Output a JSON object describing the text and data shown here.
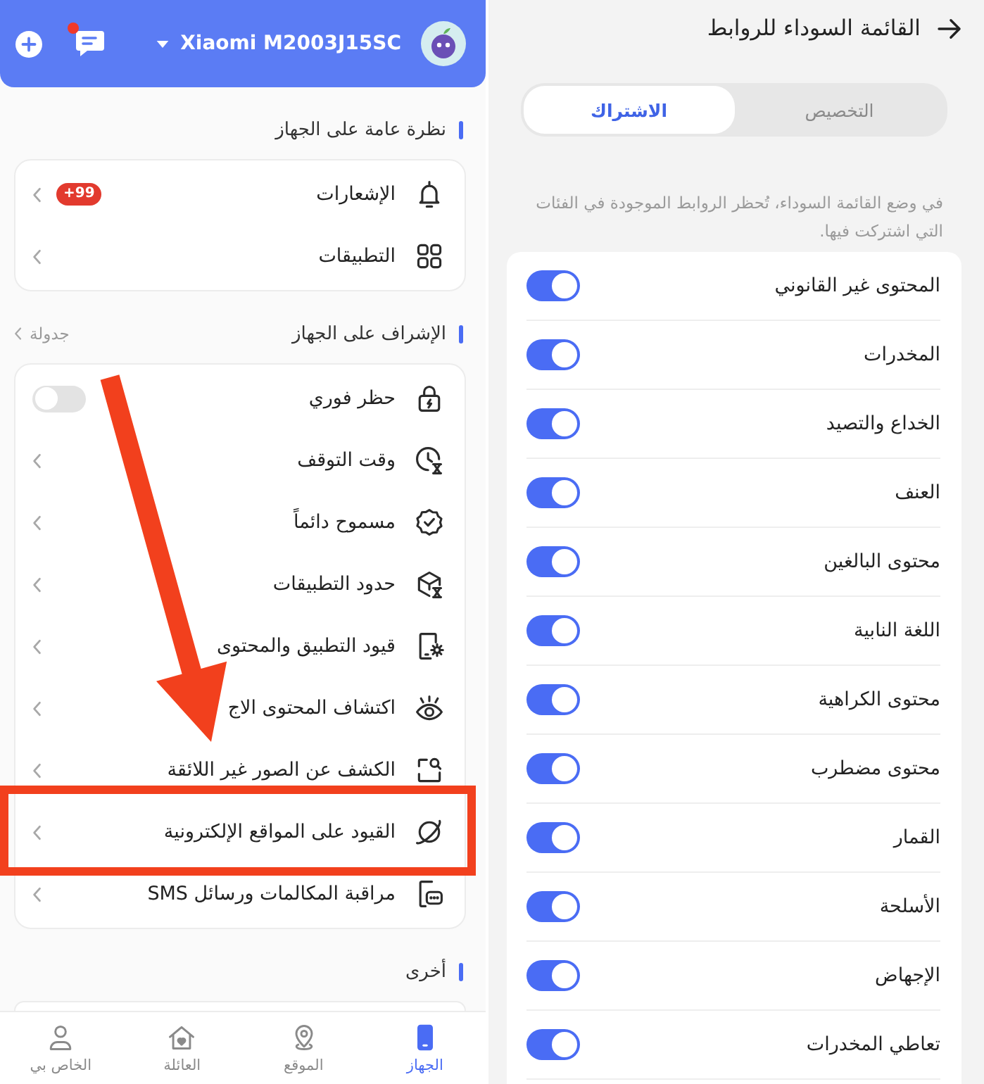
{
  "device_screen": {
    "header": {
      "device_name": "Xiaomi M2003J15SC",
      "messages_unread": true
    },
    "sections": [
      {
        "title": "نظرة عامة على الجهاز",
        "items": [
          {
            "kind": "link",
            "label": "الإشعارات",
            "badge": "+99",
            "highlighted": false
          },
          {
            "kind": "link",
            "label": "التطبيقات",
            "highlighted": false
          }
        ]
      },
      {
        "title": "الإشراف على الجهاز",
        "action": "جدولة",
        "items": [
          {
            "kind": "switch",
            "label": "حظر فوري",
            "on": false,
            "highlighted": false
          },
          {
            "kind": "link",
            "label": "وقت التوقف",
            "highlighted": false
          },
          {
            "kind": "link",
            "label": "مسموح دائماً",
            "highlighted": false
          },
          {
            "kind": "link",
            "label": "حدود التطبيقات",
            "highlighted": false
          },
          {
            "kind": "link",
            "label": "قيود التطبيق والمحتوى",
            "highlighted": false
          },
          {
            "kind": "link",
            "label": "اكتشاف المحتوى الاج",
            "highlighted": false
          },
          {
            "kind": "link",
            "label": "الكشف عن الصور غير اللائقة",
            "highlighted": false
          },
          {
            "kind": "link",
            "label": "القيود على المواقع الإلكترونية",
            "highlighted": true
          },
          {
            "kind": "link",
            "label": "مراقبة المكالمات ورسائل SMS",
            "highlighted": false
          }
        ]
      },
      {
        "title": "أخرى"
      }
    ],
    "nav": [
      {
        "label": "الجهاز",
        "selected": true
      },
      {
        "label": "الموقع",
        "selected": false
      },
      {
        "label": "العائلة",
        "selected": false
      },
      {
        "label": "الخاص بي",
        "selected": false
      }
    ]
  },
  "blacklist_screen": {
    "title": "القائمة السوداء للروابط",
    "segments": [
      {
        "label": "التخصيص",
        "selected": false
      },
      {
        "label": "الاشتراك",
        "selected": true
      }
    ],
    "description": "في وضع القائمة السوداء، تُحظر الروابط الموجودة في الفئات التي اشتركت فيها.",
    "categories": [
      {
        "label": "المحتوى غير القانوني",
        "on": true
      },
      {
        "label": "المخدرات",
        "on": true
      },
      {
        "label": "الخداع والتصيد",
        "on": true
      },
      {
        "label": "العنف",
        "on": true
      },
      {
        "label": "محتوى البالغين",
        "on": true
      },
      {
        "label": "اللغة النابية",
        "on": true
      },
      {
        "label": "محتوى الكراهية",
        "on": true
      },
      {
        "label": "محتوى مضطرب",
        "on": true
      },
      {
        "label": "القمار",
        "on": true
      },
      {
        "label": "الأسلحة",
        "on": true
      },
      {
        "label": "الإجهاض",
        "on": true
      },
      {
        "label": "تعاطي المخدرات",
        "on": true
      }
    ]
  }
}
